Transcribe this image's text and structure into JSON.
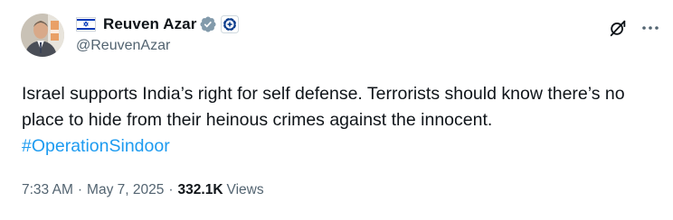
{
  "author": {
    "display_name": "Reuven Azar",
    "handle": "@ReuvenAzar",
    "flag_icon": "israel-flag-icon",
    "verified_icon": "verified-badge-icon",
    "affiliation_icon": "government-affiliation-icon",
    "verified_color": "#829aab"
  },
  "actions": {
    "grok_icon": "grok-icon",
    "more_icon": "more-options-icon"
  },
  "tweet": {
    "text": "Israel supports India’s right for self defense. Terrorists should know there’s no place to hide from their heinous crimes against the innocent.",
    "hashtag": "#OperationSindoor",
    "hashtag_color": "#1d9bf0"
  },
  "meta": {
    "time": "7:33 AM",
    "separator": "·",
    "date": "May 7, 2025",
    "views_count": "332.1K",
    "views_label": "Views"
  }
}
